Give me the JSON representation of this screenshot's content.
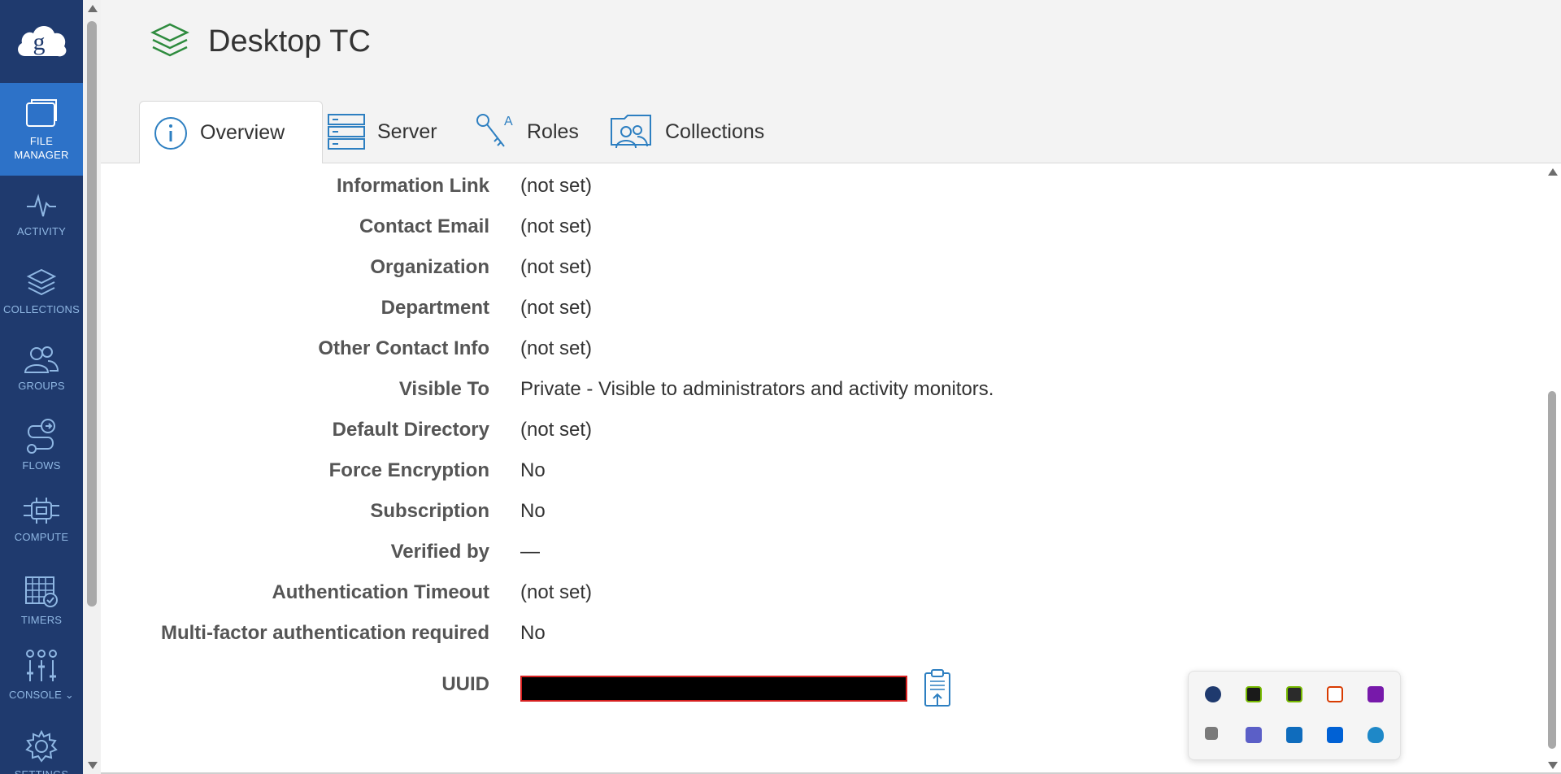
{
  "app": {
    "page_title": "Desktop TC"
  },
  "sidebar": {
    "items": [
      {
        "label": "FILE\nMANAGER",
        "icon": "folder-icon",
        "active": true
      },
      {
        "label": "ACTIVITY",
        "icon": "activity-icon"
      },
      {
        "label": "COLLECTIONS",
        "icon": "layers-icon"
      },
      {
        "label": "GROUPS",
        "icon": "users-icon"
      },
      {
        "label": "FLOWS",
        "icon": "flows-icon"
      },
      {
        "label": "COMPUTE",
        "icon": "compute-icon"
      },
      {
        "label": "TIMERS",
        "icon": "calendar-icon"
      },
      {
        "label": "CONSOLE",
        "icon": "sliders-icon"
      },
      {
        "label": "SETTINGS",
        "icon": "gear-icon"
      }
    ]
  },
  "tabs": [
    {
      "label": "Overview",
      "icon": "info-icon",
      "active": true
    },
    {
      "label": "Server",
      "icon": "server-icon"
    },
    {
      "label": "Roles",
      "icon": "key-icon"
    },
    {
      "label": "Collections",
      "icon": "collections-icon"
    }
  ],
  "details": [
    {
      "key": "Information Link",
      "value": "(not set)"
    },
    {
      "key": "Contact Email",
      "value": "(not set)"
    },
    {
      "key": "Organization",
      "value": "(not set)"
    },
    {
      "key": "Department",
      "value": "(not set)"
    },
    {
      "key": "Other Contact Info",
      "value": "(not set)"
    },
    {
      "key": "Visible To",
      "value": "Private - Visible to administrators and activity monitors."
    },
    {
      "key": "Default Directory",
      "value": "(not set)"
    },
    {
      "key": "Force Encryption",
      "value": "No"
    },
    {
      "key": "Subscription",
      "value": "No"
    },
    {
      "key": "Verified by",
      "value": "—"
    },
    {
      "key": "Authentication Timeout",
      "value": "(not set)"
    },
    {
      "key": "Multi-factor authentication required",
      "value": "No"
    },
    {
      "key": "UUID",
      "value": ""
    }
  ],
  "colors": {
    "sidebar_bg": "#1f3a6e",
    "sidebar_active": "#2d72c8",
    "accent_green": "#2e8b3e",
    "icon_blue": "#2d7fc1"
  },
  "tray": {
    "icons": [
      "globus-icon",
      "nvidia-icon",
      "nvidia-broadcast-icon",
      "office-icon",
      "onenote-icon",
      "chat-icon",
      "teams-icon",
      "outlook-icon",
      "box-icon",
      "defender-icon"
    ]
  }
}
